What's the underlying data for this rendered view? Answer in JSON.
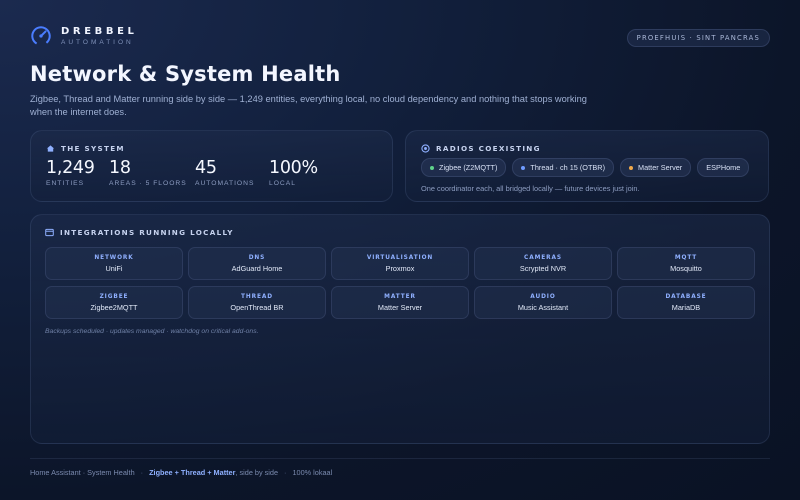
{
  "brand": {
    "name": "DREBBEL",
    "tagline": "AUTOMATION",
    "logo_icon": "gauge-icon",
    "accent": "#4a7dff"
  },
  "location": "PROEFHUIS · SINT PANCRAS",
  "page": {
    "title": "Network & System Health",
    "subtitle": "Zigbee, Thread and Matter running side by side — 1,249 entities, everything local, no cloud dependency and nothing that stops working when the internet does."
  },
  "system": {
    "heading": "THE SYSTEM",
    "icon": "house-icon",
    "stats": [
      {
        "value": "1,249",
        "label": "ENTITIES"
      },
      {
        "value": "18",
        "label": "AREAS · 5 FLOORS"
      },
      {
        "value": "45",
        "label": "AUTOMATIONS"
      },
      {
        "value": "100%",
        "label": "LOCAL"
      }
    ]
  },
  "radios": {
    "heading": "RADIOS COEXISTING",
    "icon": "radio-icon",
    "chips": [
      {
        "label": "Zigbee (Z2MQTT)",
        "dot": "#5fd38a"
      },
      {
        "label": "Thread · ch 15 (OTBR)",
        "dot": "#6f9bff"
      },
      {
        "label": "Matter Server",
        "dot": "#f0a94a"
      },
      {
        "label": "ESPHome",
        "dot": ""
      }
    ],
    "note": "One coordinator each, all bridged locally — future devices just join."
  },
  "integrations": {
    "heading": "INTEGRATIONS RUNNING LOCALLY",
    "icon": "window-icon",
    "tiles": [
      {
        "category": "NETWORK",
        "name": "UniFi"
      },
      {
        "category": "DNS",
        "name": "AdGuard Home"
      },
      {
        "category": "VIRTUALISATION",
        "name": "Proxmox"
      },
      {
        "category": "CAMERAS",
        "name": "Scrypted NVR"
      },
      {
        "category": "MQTT",
        "name": "Mosquitto"
      },
      {
        "category": "ZIGBEE",
        "name": "Zigbee2MQTT"
      },
      {
        "category": "THREAD",
        "name": "OpenThread BR"
      },
      {
        "category": "MATTER",
        "name": "Matter Server"
      },
      {
        "category": "AUDIO",
        "name": "Music Assistant"
      },
      {
        "category": "DATABASE",
        "name": "MariaDB"
      }
    ],
    "note": "Backups scheduled · updates managed · watchdog on critical add-ons."
  },
  "footer": {
    "part1": "Home Assistant · System Health",
    "highlight": "Zigbee + Thread + Matter",
    "part2": ", side by side",
    "part3": "100% lokaal"
  }
}
